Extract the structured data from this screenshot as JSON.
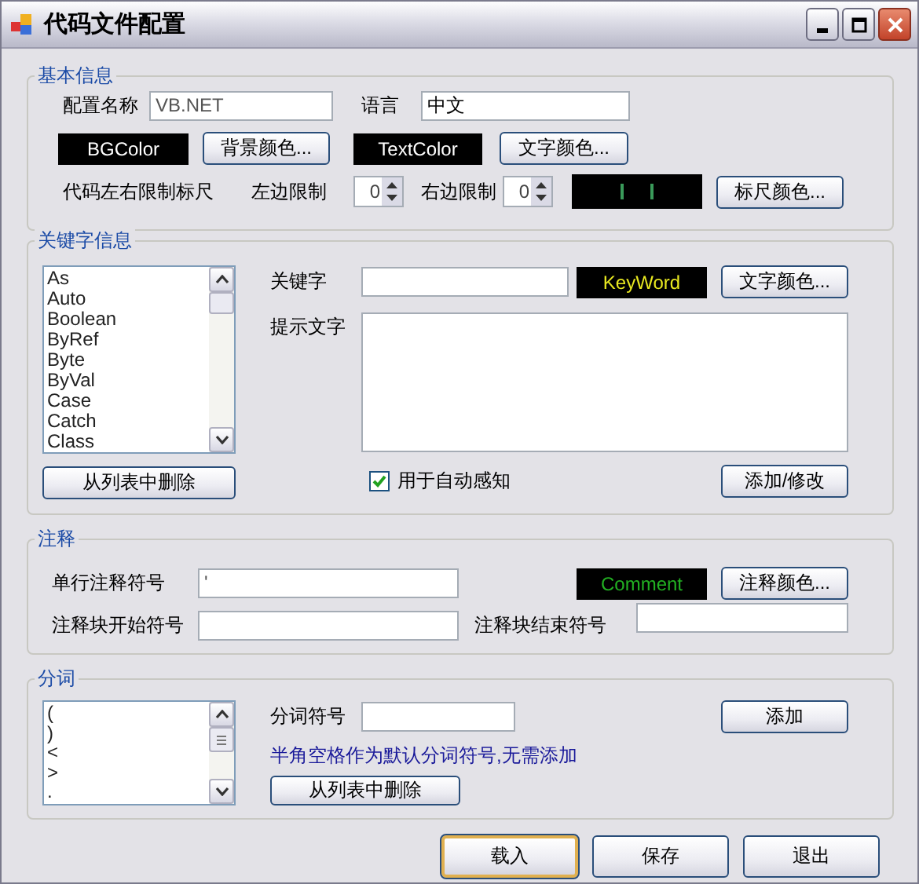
{
  "window": {
    "title": "代码文件配置"
  },
  "basic": {
    "title": "基本信息",
    "name_label": "配置名称",
    "name_value": "VB.NET",
    "language_label": "语言",
    "language_value": "中文",
    "bg_swatch": "BGColor",
    "bg_button": "背景颜色...",
    "text_swatch": "TextColor",
    "text_button": "文字颜色...",
    "ruler_label": "代码左右限制标尺",
    "left_label": "左边限制",
    "left_value": "0",
    "right_label": "右边限制",
    "right_value": "0",
    "ruler_button": "标尺颜色..."
  },
  "keywords": {
    "title": "关键字信息",
    "items": [
      "As",
      "Auto",
      "Boolean",
      "ByRef",
      "Byte",
      "ByVal",
      "Case",
      "Catch",
      "Class"
    ],
    "delete_button": "从列表中删除",
    "keyword_label": "关键字",
    "swatch": "KeyWord",
    "color_button": "文字颜色...",
    "hint_label": "提示文字",
    "autocomplete": {
      "label": "用于自动感知",
      "checked": true
    },
    "add_button": "添加/修改"
  },
  "comment": {
    "title": "注释",
    "single_label": "单行注释符号",
    "single_value": "'",
    "swatch": "Comment",
    "color_button": "注释颜色...",
    "block_start_label": "注释块开始符号",
    "block_end_label": "注释块结束符号"
  },
  "split": {
    "title": "分词",
    "items": [
      "(",
      ")",
      "<",
      ">",
      "."
    ],
    "symbol_label": "分词符号",
    "add_button": "添加",
    "note": "半角空格作为默认分词符号,无需添加",
    "delete_button": "从列表中删除"
  },
  "buttons": [
    {
      "label": "载入",
      "default": true
    },
    {
      "label": "保存",
      "default": false
    },
    {
      "label": "退出",
      "default": false
    }
  ]
}
